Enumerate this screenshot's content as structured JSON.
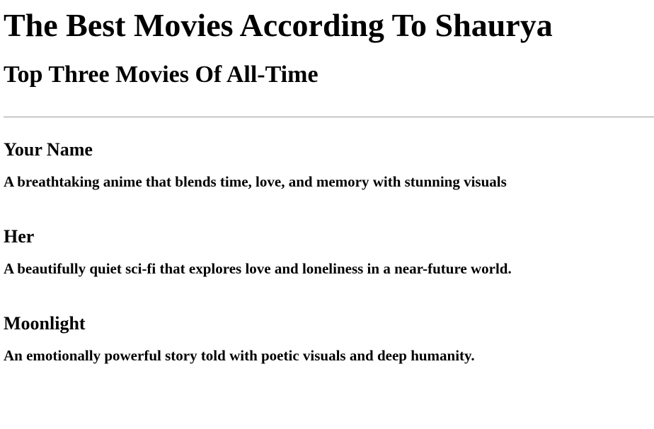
{
  "page": {
    "title": "The Best Movies According To Shaurya",
    "subtitle": "Top Three Movies Of All-Time"
  },
  "movies": [
    {
      "title": "Your Name",
      "description": "A breathtaking anime that blends time, love, and memory with stunning visuals"
    },
    {
      "title": "Her",
      "description": "A beautifully quiet sci-fi that explores love and loneliness in a near-future world."
    },
    {
      "title": "Moonlight",
      "description": "An emotionally powerful story told with poetic visuals and deep humanity."
    }
  ]
}
